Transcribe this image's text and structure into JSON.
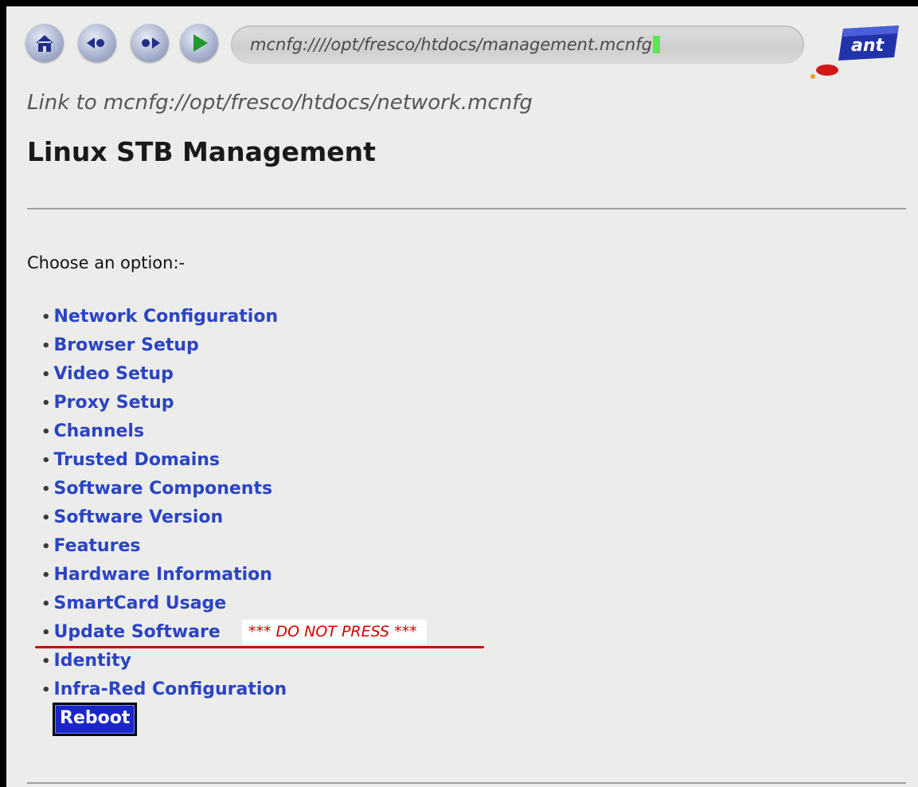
{
  "toolbar": {
    "buttons": [
      "home-icon",
      "back-icon",
      "forward-icon",
      "go-icon"
    ],
    "address": "mcnfg:////opt/fresco/htdocs/management.mcnfg",
    "logo_text": "ant"
  },
  "status": {
    "link_text": "Link to mcnfg://opt/fresco/htdocs/network.mcnfg"
  },
  "page": {
    "title": "Linux STB Management",
    "prompt": "Choose an option:-",
    "menu": [
      "Network Configuration",
      "Browser Setup",
      "Video Setup",
      "Proxy Setup",
      "Channels",
      "Trusted Domains",
      "Software Components",
      "Software Version",
      "Features",
      "Hardware Information",
      "SmartCard Usage",
      "Update Software",
      "Identity",
      "Infra-Red Configuration"
    ],
    "reboot": "Reboot",
    "warning": "*** DO NOT PRESS ***"
  },
  "colors": {
    "link": "#2b44c4",
    "warning": "#d40000",
    "focus_bg": "#1a26c8"
  }
}
